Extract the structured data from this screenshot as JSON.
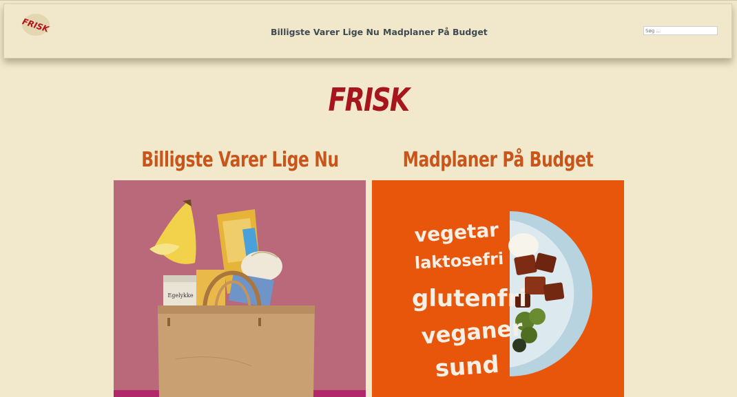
{
  "header": {
    "logo_text": "FRISK",
    "nav": [
      {
        "label": "Billigste Varer Lige Nu"
      },
      {
        "label": "Madplaner På Budget"
      }
    ],
    "search": {
      "placeholder": "Søg ...",
      "value": ""
    }
  },
  "hero": {
    "title": "FRISK"
  },
  "cards": [
    {
      "title": "Billigste Varer Lige Nu",
      "image_text": "Egelykke"
    },
    {
      "title": "Madplaner På Budget",
      "words": [
        "vegetar",
        "laktosefri",
        "glutenfri",
        "veganer",
        "sund"
      ]
    }
  ],
  "colors": {
    "background": "#f2e9cd",
    "brand_red": "#a8161d",
    "card_title_orange": "#c8551a",
    "left_card_bg": "#b9697a",
    "right_card_bg": "#e8560c"
  }
}
